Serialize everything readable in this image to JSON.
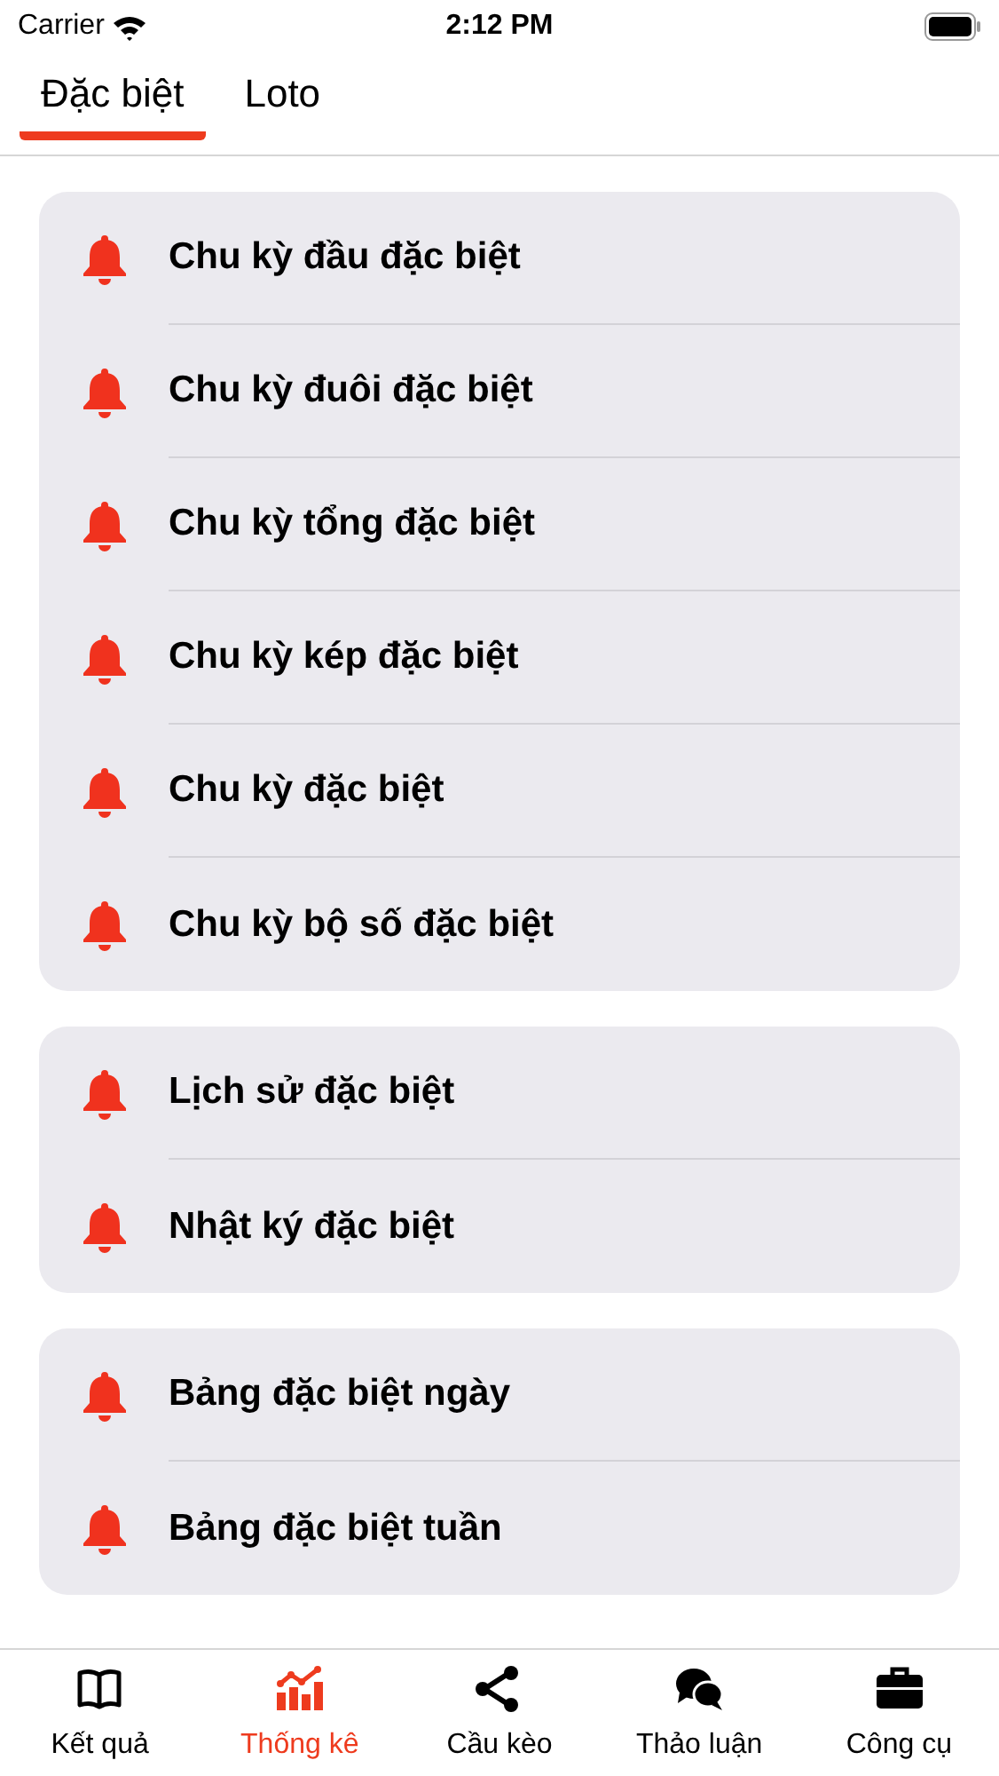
{
  "status_bar": {
    "carrier": "Carrier",
    "time": "2:12 PM"
  },
  "tabs": [
    {
      "label": "Đặc biệt",
      "selected": true
    },
    {
      "label": "Loto",
      "selected": false
    }
  ],
  "groups": [
    {
      "items": [
        "Chu kỳ đầu đặc biệt",
        "Chu kỳ đuôi đặc biệt",
        "Chu kỳ tổng đặc biệt",
        "Chu kỳ kép đặc biệt",
        "Chu kỳ đặc biệt",
        "Chu kỳ bộ số đặc biệt"
      ]
    },
    {
      "items": [
        "Lịch sử đặc biệt",
        "Nhật ký đặc biệt"
      ]
    },
    {
      "items": [
        "Bảng đặc biệt ngày",
        "Bảng đặc biệt tuần"
      ]
    }
  ],
  "tab_bar": [
    {
      "label": "Kết quả",
      "kind": "book",
      "selected": false
    },
    {
      "label": "Thống kê",
      "kind": "chart",
      "selected": true
    },
    {
      "label": "Cầu kèo",
      "kind": "share",
      "selected": false
    },
    {
      "label": "Thảo luận",
      "kind": "chat",
      "selected": false
    },
    {
      "label": "Công cụ",
      "kind": "briefcase",
      "selected": false
    }
  ]
}
